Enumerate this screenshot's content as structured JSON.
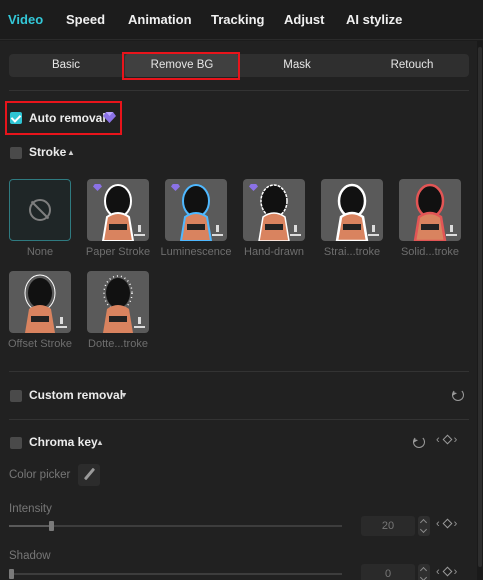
{
  "nav_tabs": [
    "Video",
    "Speed",
    "Animation",
    "Tracking",
    "Adjust",
    "AI stylize"
  ],
  "sub_tabs": [
    "Basic",
    "Remove BG",
    "Mask",
    "Retouch"
  ],
  "auto_removal": {
    "label": "Auto removal",
    "checked": true
  },
  "stroke": {
    "label": "Stroke",
    "checked": false,
    "options": [
      "None",
      "Paper Stroke",
      "Luminescence",
      "Hand-drawn",
      "Strai...troke",
      "Solid...troke",
      "Offset Stroke",
      "Dotte...troke"
    ]
  },
  "custom_removal": {
    "label": "Custom removal",
    "checked": false
  },
  "chroma_key": {
    "label": "Chroma key",
    "checked": false,
    "color_picker_label": "Color picker",
    "intensity": {
      "label": "Intensity",
      "value": "20",
      "level": 20
    },
    "shadow": {
      "label": "Shadow",
      "value": "0",
      "level": 0
    }
  },
  "colors": {
    "accent": "#33c8d8",
    "highlight": "#e8141b",
    "premium": "#8b72e6"
  },
  "icons": [
    "none-icon",
    "download-icon",
    "premium-gem-icon",
    "reset-icon",
    "keyframe-diamond-icon",
    "eyedropper-icon"
  ]
}
